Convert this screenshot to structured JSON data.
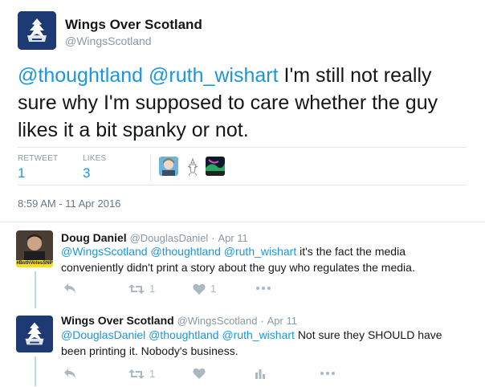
{
  "main_tweet": {
    "author_name": "Wings Over Scotland",
    "author_handle": "@WingsScotland",
    "mentions": [
      "@thoughtland",
      "@ruth_wishart"
    ],
    "text": "I'm still not really sure why I'm supposed to care whether the guy likes it a bit spanky or not.",
    "retweets_label": "RETWEET",
    "retweets_count": "1",
    "likes_label": "LIKES",
    "likes_count": "3",
    "timestamp": "8:59 AM - 11 Apr 2016"
  },
  "replies": [
    {
      "author_name": "Doug Daniel",
      "author_handle": "@DouglasDaniel",
      "date": "Apr 11",
      "mentions": [
        "@WingsScotland",
        "@thoughtland",
        "@ruth_wishart"
      ],
      "text_line1": "it's the fact the media",
      "text_line2": "conveniently didn't print a story about the guy who regulates the media.",
      "avatar_badge": "#BothVotesSNP",
      "retweet_count": "1",
      "like_count": "1"
    },
    {
      "author_name": "Wings Over Scotland",
      "author_handle": "@WingsScotland",
      "date": "Apr 11",
      "mentions": [
        "@DouglasDaniel",
        "@thoughtland",
        "@ruth_wishart"
      ],
      "text_line1": "Not sure they SHOULD have",
      "text_line2": "been printing it. Nobody's business.",
      "retweet_count": "1"
    }
  ],
  "colors": {
    "link": "#1b95e0",
    "brand_avatar": "#1d3a73",
    "meta": "#8899a6",
    "icon": "#aab8c2"
  }
}
